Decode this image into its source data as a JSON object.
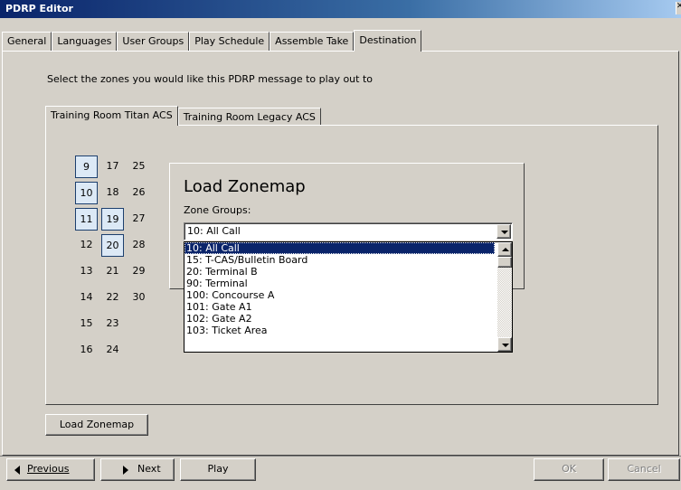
{
  "window": {
    "title": "PDRP Editor"
  },
  "tabs": [
    {
      "label": "General"
    },
    {
      "label": "Languages"
    },
    {
      "label": "User Groups"
    },
    {
      "label": "Play Schedule"
    },
    {
      "label": "Assemble Take"
    },
    {
      "label": "Destination"
    }
  ],
  "active_tab": "Destination",
  "destination": {
    "instruction": "Select the zones you would like this PDRP message to play out to",
    "zone_tabs": [
      {
        "label": "Training Room Titan ACS"
      },
      {
        "label": "Training Room Legacy ACS"
      }
    ],
    "zones": [
      {
        "number": "9",
        "selected": true
      },
      {
        "number": "10",
        "selected": true
      },
      {
        "number": "11",
        "selected": true
      },
      {
        "number": "12",
        "selected": false
      },
      {
        "number": "13",
        "selected": false
      },
      {
        "number": "14",
        "selected": false
      },
      {
        "number": "15",
        "selected": false
      },
      {
        "number": "16",
        "selected": false
      },
      {
        "number": "17",
        "selected": false
      },
      {
        "number": "18",
        "selected": false
      },
      {
        "number": "19",
        "selected": true
      },
      {
        "number": "20",
        "selected": true
      },
      {
        "number": "21",
        "selected": false
      },
      {
        "number": "22",
        "selected": false
      },
      {
        "number": "23",
        "selected": false
      },
      {
        "number": "24",
        "selected": false
      },
      {
        "number": "25",
        "selected": false
      },
      {
        "number": "26",
        "selected": false
      },
      {
        "number": "27",
        "selected": false
      },
      {
        "number": "28",
        "selected": false
      },
      {
        "number": "29",
        "selected": false
      },
      {
        "number": "30",
        "selected": false
      }
    ],
    "load_zonemap_button": "Load Zonemap"
  },
  "dialog": {
    "title": "Load Zonemap",
    "zone_groups_label": "Zone Groups:",
    "selected_value": "10: All Call",
    "options": [
      "10: All Call",
      "15: T-CAS/Bulletin Board",
      "20: Terminal B",
      "90: Terminal",
      "100: Concourse A",
      "101: Gate A1",
      "102: Gate A2",
      "103: Ticket Area"
    ]
  },
  "bottom": {
    "previous": "Previous",
    "next": "Next",
    "play": "Play",
    "ok": "OK",
    "cancel": "Cancel"
  },
  "colors": {
    "face": "#d4d0c8",
    "selection": "#0a246a",
    "zone_selected": "#dce9f6"
  }
}
